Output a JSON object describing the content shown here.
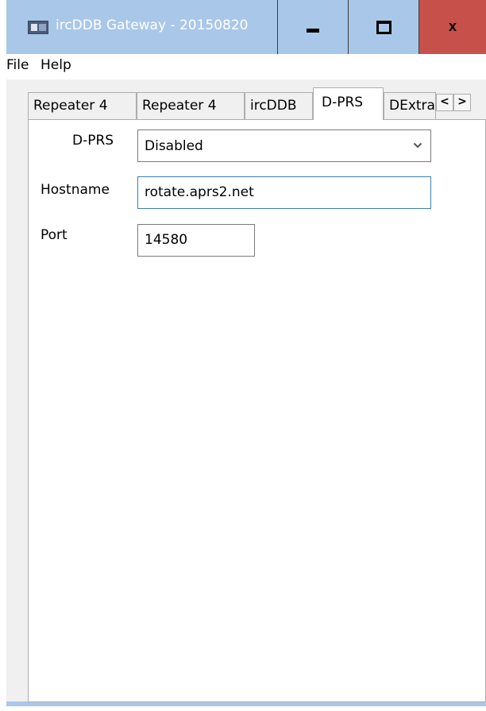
{
  "window": {
    "title": "ircDDB Gateway - 20150820",
    "close_glyph": "x",
    "colors": {
      "titlebar": "#a9c7e8",
      "close_button": "#c7504b"
    },
    "icons": [
      "app-icon",
      "minimize-icon",
      "maximize-icon",
      "close-icon"
    ]
  },
  "menu": {
    "file": "File",
    "help": "Help"
  },
  "tabs": [
    {
      "label": "Repeater 4",
      "active": false
    },
    {
      "label": "Repeater 4",
      "active": false
    },
    {
      "label": "ircDDB",
      "active": false
    },
    {
      "label": "D-PRS",
      "active": true
    },
    {
      "label": "DExtra",
      "active": false
    }
  ],
  "tab_scroll": {
    "left": "<",
    "right": ">"
  },
  "form": {
    "dprs_label": "D-PRS",
    "dprs_value": "Disabled",
    "hostname_label": "Hostname",
    "hostname_value": "rotate.aprs2.net",
    "port_label": "Port",
    "port_value": "14580"
  }
}
